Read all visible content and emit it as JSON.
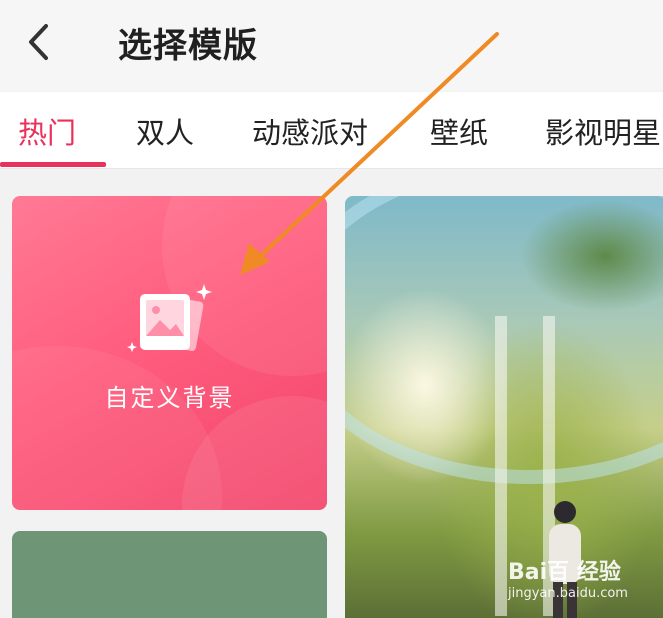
{
  "header": {
    "title": "选择模版",
    "back_icon": "chevron-left-icon"
  },
  "tabs": [
    {
      "label": "热门",
      "active": true
    },
    {
      "label": "双人",
      "active": false
    },
    {
      "label": "动感派对",
      "active": false
    },
    {
      "label": "壁纸",
      "active": false
    },
    {
      "label": "影视明星",
      "active": false
    }
  ],
  "custom_template": {
    "label": "自定义背景",
    "icon": "image-add-icon"
  },
  "watermark": {
    "brand": "Bai百 经验",
    "site": "jingyan.baidu.com"
  },
  "colors": {
    "accent": "#e8315b",
    "custom_card": "#ff5d7e",
    "green_card": "#6e9676",
    "annotation_arrow": "#f08a24"
  }
}
